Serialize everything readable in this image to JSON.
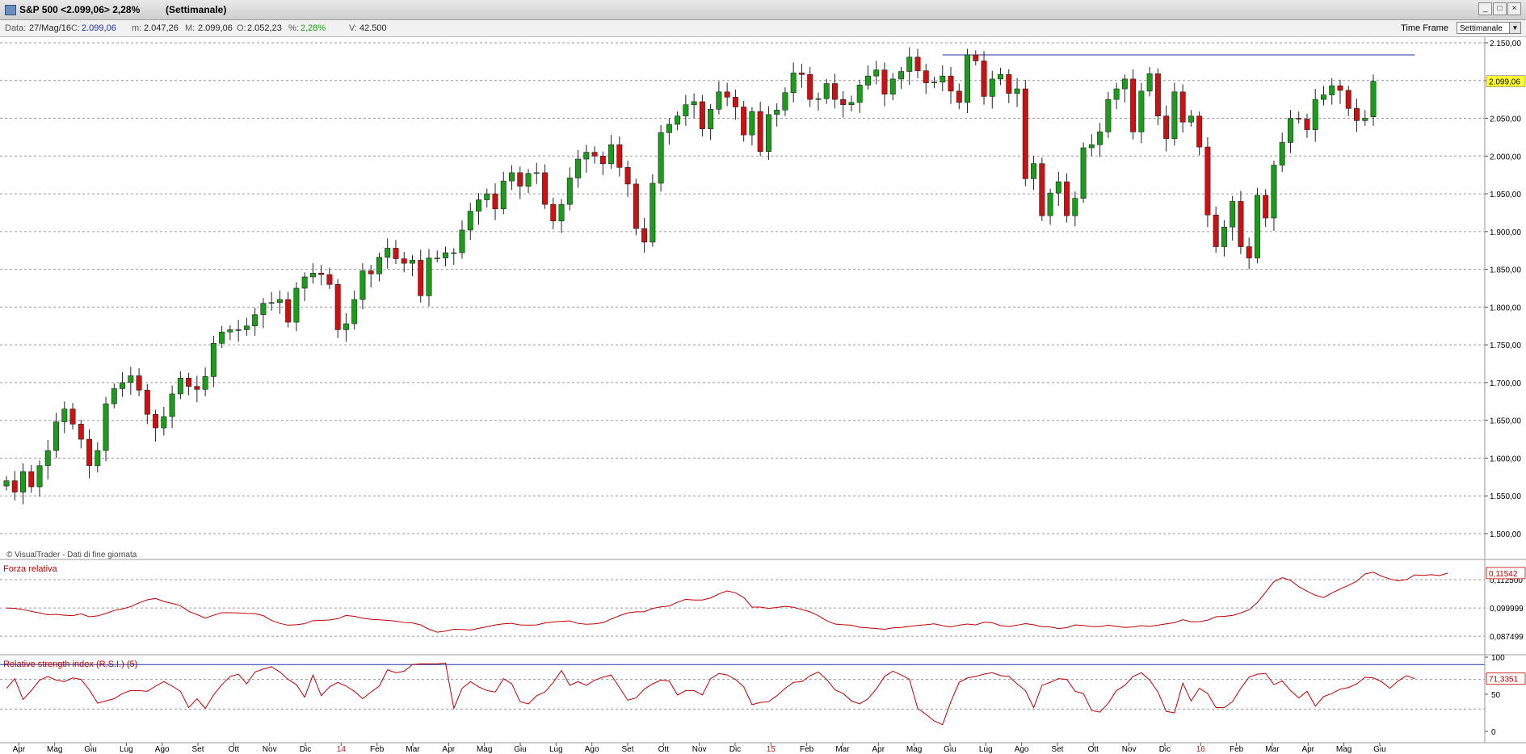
{
  "window": {
    "title": "S&P 500 <2.099,06> 2,28%",
    "subtitle": "(Settimanale)",
    "buttons": [
      "_",
      "□",
      "×"
    ]
  },
  "infobar": {
    "data_label": "Data:",
    "data_value": "27/Mag/16",
    "c_label": "C:",
    "c_value": "2.099,06",
    "m_label": "m:",
    "m_value": "2.047,26",
    "M_label": "M:",
    "M_value": "2.099,06",
    "o_label": "O:",
    "o_value": "2.052,23",
    "pct_label": "%:",
    "pct_value": "2,28%",
    "v_label": "V:",
    "v_value": "42.500",
    "timeframe_label": "Time Frame",
    "timeframe_value": "Settimanale"
  },
  "colors": {
    "up": "#1a9e1a",
    "down": "#d01010",
    "indicator": "#c00000",
    "hline": "#1c2fa0",
    "last_price_bg": "#ffff33",
    "grid": "#9a9a9a"
  },
  "chart_data": [
    {
      "type": "candlestick",
      "ylim": [
        1500,
        2150
      ],
      "y_ticks": [
        "2.150,00",
        "2.100,00",
        "2.050,00",
        "2.000,00",
        "1.950,00",
        "1.900,00",
        "1.850,00",
        "1.800,00",
        "1.750,00",
        "1.700,00",
        "1.650,00",
        "1.600,00",
        "1.550,00",
        "1.500,00"
      ],
      "last_price_label": "2.099,06",
      "last_close": 2099.06,
      "resistance_level": 2134,
      "watermark": "© VisualTrader - Dati di fine giornata",
      "x_ticks": [
        "Apr",
        "Mag",
        "Giu",
        "Lug",
        "Ago",
        "Set",
        "Ott",
        "Nov",
        "Dic",
        "14",
        "Feb",
        "Mar",
        "Apr",
        "Mag",
        "Giu",
        "Lug",
        "Ago",
        "Set",
        "Ott",
        "Nov",
        "Dic",
        "15",
        "Feb",
        "Mar",
        "Apr",
        "Mag",
        "Giu",
        "Lug",
        "Ago",
        "Set",
        "Ott",
        "Nov",
        "Dic",
        "16",
        "Feb",
        "Mar",
        "Apr",
        "Mag",
        "Giu"
      ],
      "x_tick_red": [
        "14",
        "15",
        "16"
      ],
      "closes": [
        1570,
        1555,
        1582,
        1562,
        1590,
        1610,
        1648,
        1665,
        1645,
        1625,
        1590,
        1610,
        1672,
        1692,
        1700,
        1709,
        1690,
        1658,
        1640,
        1655,
        1685,
        1706,
        1695,
        1691,
        1708,
        1752,
        1767,
        1770,
        1770,
        1775,
        1790,
        1805,
        1806,
        1810,
        1780,
        1825,
        1840,
        1845,
        1843,
        1830,
        1770,
        1778,
        1810,
        1848,
        1844,
        1866,
        1878,
        1864,
        1858,
        1862,
        1815,
        1865,
        1865,
        1872,
        1872,
        1902,
        1927,
        1942,
        1950,
        1930,
        1967,
        1978,
        1960,
        1977,
        1978,
        1936,
        1914,
        1936,
        1971,
        1996,
        2005,
        2000,
        1990,
        2015,
        1985,
        1963,
        1904,
        1886,
        1964,
        2031,
        2042,
        2053,
        2068,
        2072,
        2036,
        2062,
        2085,
        2078,
        2065,
        2028,
        2059,
        2006,
        2055,
        2061,
        2084,
        2110,
        2108,
        2075,
        2076,
        2096,
        2075,
        2068,
        2071,
        2094,
        2106,
        2114,
        2082,
        2102,
        2112,
        2131,
        2113,
        2097,
        2098,
        2106,
        2086,
        2071,
        2134,
        2126,
        2079,
        2102,
        2108,
        2083,
        2089,
        1970,
        1990,
        1921,
        1951,
        1966,
        1921,
        1944,
        2011,
        2015,
        2032,
        2075,
        2089,
        2102,
        2032,
        2086,
        2109,
        2053,
        2023,
        2085,
        2045,
        2053,
        2012,
        1922,
        1880,
        1906,
        1940,
        1880,
        1865,
        1948,
        1918,
        1988,
        2018,
        2050,
        2049,
        2035,
        2075,
        2081,
        2093,
        2087,
        2063,
        2047,
        2050,
        2099
      ],
      "opens": [
        1563,
        1570,
        1555,
        1582,
        1562,
        1590,
        1610,
        1648,
        1665,
        1645,
        1625,
        1590,
        1610,
        1672,
        1692,
        1700,
        1709,
        1690,
        1658,
        1640,
        1655,
        1685,
        1706,
        1695,
        1691,
        1708,
        1752,
        1767,
        1770,
        1770,
        1775,
        1790,
        1805,
        1806,
        1810,
        1780,
        1825,
        1840,
        1845,
        1843,
        1830,
        1770,
        1778,
        1810,
        1848,
        1844,
        1866,
        1878,
        1864,
        1858,
        1862,
        1815,
        1865,
        1865,
        1872,
        1872,
        1902,
        1927,
        1942,
        1950,
        1930,
        1967,
        1978,
        1960,
        1977,
        1978,
        1936,
        1914,
        1936,
        1971,
        1996,
        2005,
        2000,
        1990,
        2015,
        1985,
        1963,
        1904,
        1886,
        1964,
        2031,
        2042,
        2053,
        2068,
        2072,
        2036,
        2062,
        2085,
        2078,
        2065,
        2028,
        2059,
        2006,
        2055,
        2061,
        2084,
        2110,
        2108,
        2075,
        2076,
        2096,
        2075,
        2068,
        2071,
        2094,
        2106,
        2114,
        2082,
        2102,
        2112,
        2131,
        2113,
        2097,
        2098,
        2106,
        2086,
        2071,
        2134,
        2126,
        2079,
        2102,
        2108,
        2083,
        2089,
        1970,
        1990,
        1921,
        1951,
        1966,
        1921,
        1944,
        2011,
        2015,
        2032,
        2075,
        2089,
        2102,
        2032,
        2086,
        2109,
        2053,
        2023,
        2085,
        2045,
        2053,
        2012,
        1922,
        1880,
        1906,
        1940,
        1880,
        1865,
        1948,
        1918,
        1988,
        2018,
        2050,
        2049,
        2035,
        2075,
        2081,
        2093,
        2087,
        2063,
        2047,
        2052
      ],
      "rel_strength": {
        "label": "Forza relativa",
        "value_label": "0,11542",
        "y_ticks": [
          "0,112500",
          "0,099999",
          "0,087499"
        ],
        "ylim": [
          0.084,
          0.1175
        ],
        "values": [
          0.1,
          0.0998,
          0.0993,
          0.0985,
          0.0978,
          0.097,
          0.0972,
          0.0968,
          0.0966,
          0.0974,
          0.0961,
          0.0965,
          0.0976,
          0.0989,
          0.0996,
          0.1006,
          0.1023,
          0.1036,
          0.1042,
          0.1029,
          0.102,
          0.101,
          0.0985,
          0.0971,
          0.0955,
          0.0968,
          0.0979,
          0.0979,
          0.0978,
          0.0976,
          0.0975,
          0.0966,
          0.0945,
          0.0932,
          0.0924,
          0.0926,
          0.0931,
          0.0944,
          0.0945,
          0.0947,
          0.0953,
          0.0967,
          0.0963,
          0.0955,
          0.095,
          0.0948,
          0.0945,
          0.0942,
          0.0936,
          0.0934,
          0.0925,
          0.0906,
          0.0893,
          0.0898,
          0.0906,
          0.0905,
          0.0903,
          0.091,
          0.0917,
          0.0925,
          0.093,
          0.0932,
          0.0925,
          0.0924,
          0.0925,
          0.0934,
          0.0938,
          0.0941,
          0.0943,
          0.0932,
          0.0928,
          0.093,
          0.0935,
          0.0951,
          0.0966,
          0.0978,
          0.0983,
          0.0983,
          0.0998,
          0.1005,
          0.1009,
          0.1025,
          0.1038,
          0.1035,
          0.1035,
          0.1044,
          0.1062,
          0.1075,
          0.1067,
          0.1046,
          0.1004,
          0.1004,
          0.0998,
          0.1002,
          0.1007,
          0.1003,
          0.0993,
          0.0983,
          0.0966,
          0.0944,
          0.0929,
          0.0926,
          0.0924,
          0.0915,
          0.0912,
          0.0909,
          0.0906,
          0.0912,
          0.0914,
          0.0919,
          0.0923,
          0.0926,
          0.093,
          0.0922,
          0.0916,
          0.0924,
          0.0929,
          0.0925,
          0.0937,
          0.0935,
          0.0922,
          0.0918,
          0.0924,
          0.0931,
          0.0926,
          0.0917,
          0.0916,
          0.0909,
          0.0913,
          0.0925,
          0.0923,
          0.0918,
          0.0918,
          0.0924,
          0.0919,
          0.0914,
          0.0916,
          0.0922,
          0.0919,
          0.0924,
          0.093,
          0.0935,
          0.0948,
          0.0939,
          0.094,
          0.0946,
          0.0961,
          0.0963,
          0.0967,
          0.0978,
          0.0992,
          0.1024,
          0.107,
          0.1116,
          0.1134,
          0.1122,
          0.1094,
          0.1074,
          0.1056,
          0.1046,
          0.1066,
          0.1084,
          0.11,
          0.1118,
          0.115,
          0.1158,
          0.114,
          0.1128,
          0.112,
          0.1125,
          0.1146,
          0.1144,
          0.1147,
          0.1143,
          0.1154
        ]
      },
      "rsi": {
        "label": "Relative strength index (R.S.I.) (5)",
        "value_label": "71,3351",
        "y_ticks": [
          "100",
          "50",
          "0"
        ],
        "ylim": [
          0,
          100
        ],
        "overbought": 90,
        "values": [
          58,
          71,
          43,
          55,
          69,
          74,
          69,
          67,
          72,
          70,
          56,
          38,
          41,
          44,
          51,
          55,
          55,
          54,
          61,
          67,
          61,
          54,
          32,
          44,
          31,
          49,
          63,
          74,
          77,
          64,
          80,
          84,
          87,
          80,
          70,
          63,
          46,
          76,
          48,
          60,
          66,
          61,
          54,
          44,
          53,
          61,
          83,
          79,
          81,
          90,
          91,
          91,
          91,
          92,
          31,
          58,
          67,
          60,
          55,
          53,
          71,
          64,
          40,
          37,
          48,
          53,
          66,
          82,
          62,
          67,
          62,
          69,
          73,
          76,
          59,
          42,
          45,
          57,
          64,
          69,
          68,
          49,
          55,
          55,
          49,
          71,
          78,
          76,
          70,
          60,
          36,
          39,
          40,
          48,
          58,
          66,
          67,
          75,
          80,
          70,
          56,
          51,
          41,
          37,
          44,
          57,
          74,
          81,
          76,
          70,
          31,
          23,
          14,
          9,
          40,
          66,
          72,
          74,
          77,
          79,
          75,
          74,
          64,
          55,
          32,
          62,
          66,
          71,
          70,
          54,
          51,
          28,
          26,
          38,
          55,
          62,
          74,
          79,
          69,
          53,
          27,
          25,
          65,
          41,
          58,
          51,
          32,
          32,
          40,
          58,
          73,
          77,
          78,
          63,
          68,
          55,
          45,
          54,
          34,
          47,
          51,
          57,
          59,
          64,
          73,
          72,
          67,
          58,
          68,
          75,
          71
        ]
      }
    }
  ]
}
